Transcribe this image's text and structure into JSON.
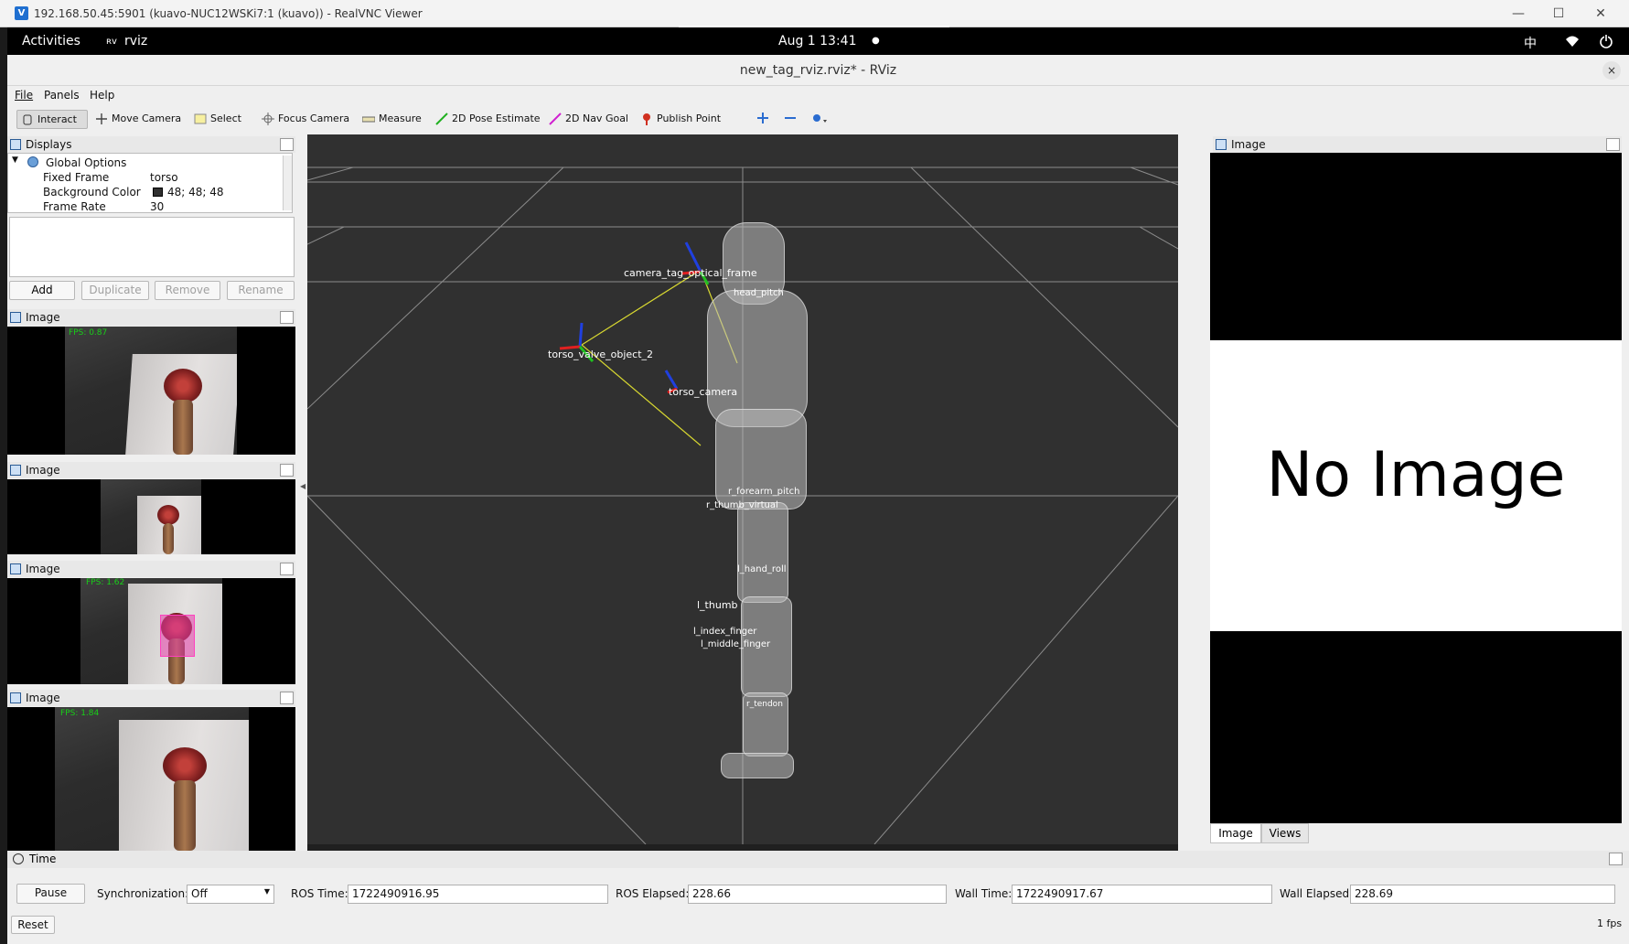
{
  "vnc": {
    "title": "192.168.50.45:5901 (kuavo-NUC12WSKi7:1 (kuavo)) - RealVNC Viewer",
    "minimize": "—",
    "maximize": "☐",
    "close": "✕"
  },
  "gnome": {
    "activities": "Activities",
    "app_name": "rviz",
    "datetime": "Aug 1  13:41",
    "dot": "●",
    "lang": "中"
  },
  "window": {
    "title": "new_tag_rviz.rviz* - RViz",
    "close": "×"
  },
  "menu": [
    "File",
    "Panels",
    "Help"
  ],
  "toolbar": {
    "interact": "Interact",
    "move_camera": "Move Camera",
    "select": "Select",
    "focus_camera": "Focus Camera",
    "measure": "Measure",
    "pose_estimate": "2D Pose Estimate",
    "nav_goal": "2D Nav Goal",
    "publish_point": "Publish Point"
  },
  "displays": {
    "title": "Displays",
    "global_options": "Global Options",
    "rows": [
      {
        "key": "Fixed Frame",
        "value": "torso"
      },
      {
        "key": "Background Color",
        "value": "48; 48; 48"
      },
      {
        "key": "Frame Rate",
        "value": "30"
      }
    ],
    "buttons": {
      "add": "Add",
      "duplicate": "Duplicate",
      "remove": "Remove",
      "rename": "Rename"
    }
  },
  "image_panels": [
    {
      "title": "Image",
      "fps": "FPS: 0.87"
    },
    {
      "title": "Image",
      "fps": ""
    },
    {
      "title": "Image",
      "fps": "FPS: 1.62"
    },
    {
      "title": "Image",
      "fps": "FPS: 1.84"
    }
  ],
  "view3d": {
    "labels": [
      "camera_tag_optical_frame",
      "head_pitch",
      "torso_valve_object_2",
      "torso_camera",
      "r_forearm_pitch",
      "r_thumb_virtual",
      "l_hand_roll",
      "l_thumb",
      "l_index_finger",
      "l_middle_finger",
      "r_tendon"
    ]
  },
  "right_panel": {
    "title": "Image",
    "no_image": "No Image",
    "tabs": [
      "Image",
      "Views"
    ]
  },
  "time": {
    "title": "Time",
    "pause": "Pause",
    "sync_label": "Synchronization:",
    "sync_value": "Off",
    "ros_time_label": "ROS Time:",
    "ros_time": "1722490916.95",
    "ros_elapsed_label": "ROS Elapsed:",
    "ros_elapsed": "228.66",
    "wall_time_label": "Wall Time:",
    "wall_time": "1722490917.67",
    "wall_elapsed_label": "Wall Elapsed:",
    "wall_elapsed": "228.69",
    "reset": "Reset",
    "fps": "1 fps"
  },
  "colors": {
    "background": "#303030",
    "grid": "#a0a0a0",
    "fps_text": "#18d018",
    "axis_x": "#e02020",
    "axis_y": "#20c020",
    "axis_z": "#2040e0",
    "tf_link": "#d8d830"
  }
}
